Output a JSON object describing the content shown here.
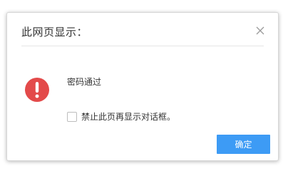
{
  "dialog": {
    "title": "此网页显示：",
    "close_icon": "close-icon",
    "alert_icon": "exclamation-circle-icon",
    "alert_color": "#e34a4a",
    "message": "密码通过",
    "checkbox": {
      "label": "禁止此页再显示对话框。",
      "checked": false
    },
    "ok_label": "确定",
    "ok_color": "#3d9bf5"
  }
}
